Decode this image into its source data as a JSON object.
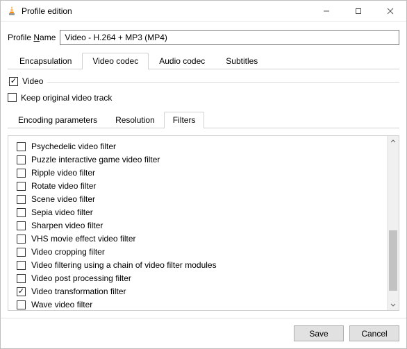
{
  "window": {
    "title": "Profile edition"
  },
  "profile": {
    "label_pre": "Profile ",
    "label_underlined": "N",
    "label_post": "ame",
    "value": "Video - H.264 + MP3 (MP4)"
  },
  "tabs_top": {
    "items": [
      {
        "label": "Encapsulation",
        "active": false
      },
      {
        "label": "Video codec",
        "active": true
      },
      {
        "label": "Audio codec",
        "active": false
      },
      {
        "label": "Subtitles",
        "active": false
      }
    ]
  },
  "video_ck": {
    "checked": true,
    "label": "Video"
  },
  "keep_ck": {
    "checked": false,
    "label": "Keep original video track"
  },
  "tabs_sub": {
    "items": [
      {
        "label": "Encoding parameters",
        "active": false
      },
      {
        "label": "Resolution",
        "active": false
      },
      {
        "label": "Filters",
        "active": true
      }
    ]
  },
  "filters": [
    {
      "label": "Psychedelic video filter",
      "checked": false
    },
    {
      "label": "Puzzle interactive game video filter",
      "checked": false
    },
    {
      "label": "Ripple video filter",
      "checked": false
    },
    {
      "label": "Rotate video filter",
      "checked": false
    },
    {
      "label": "Scene video filter",
      "checked": false
    },
    {
      "label": "Sepia video filter",
      "checked": false
    },
    {
      "label": "Sharpen video filter",
      "checked": false
    },
    {
      "label": "VHS movie effect video filter",
      "checked": false
    },
    {
      "label": "Video cropping filter",
      "checked": false
    },
    {
      "label": "Video filtering using a chain of video filter modules",
      "checked": false
    },
    {
      "label": "Video post processing filter",
      "checked": false
    },
    {
      "label": "Video transformation filter",
      "checked": true
    },
    {
      "label": "Wave video filter",
      "checked": false
    }
  ],
  "buttons": {
    "save": "Save",
    "cancel": "Cancel"
  }
}
